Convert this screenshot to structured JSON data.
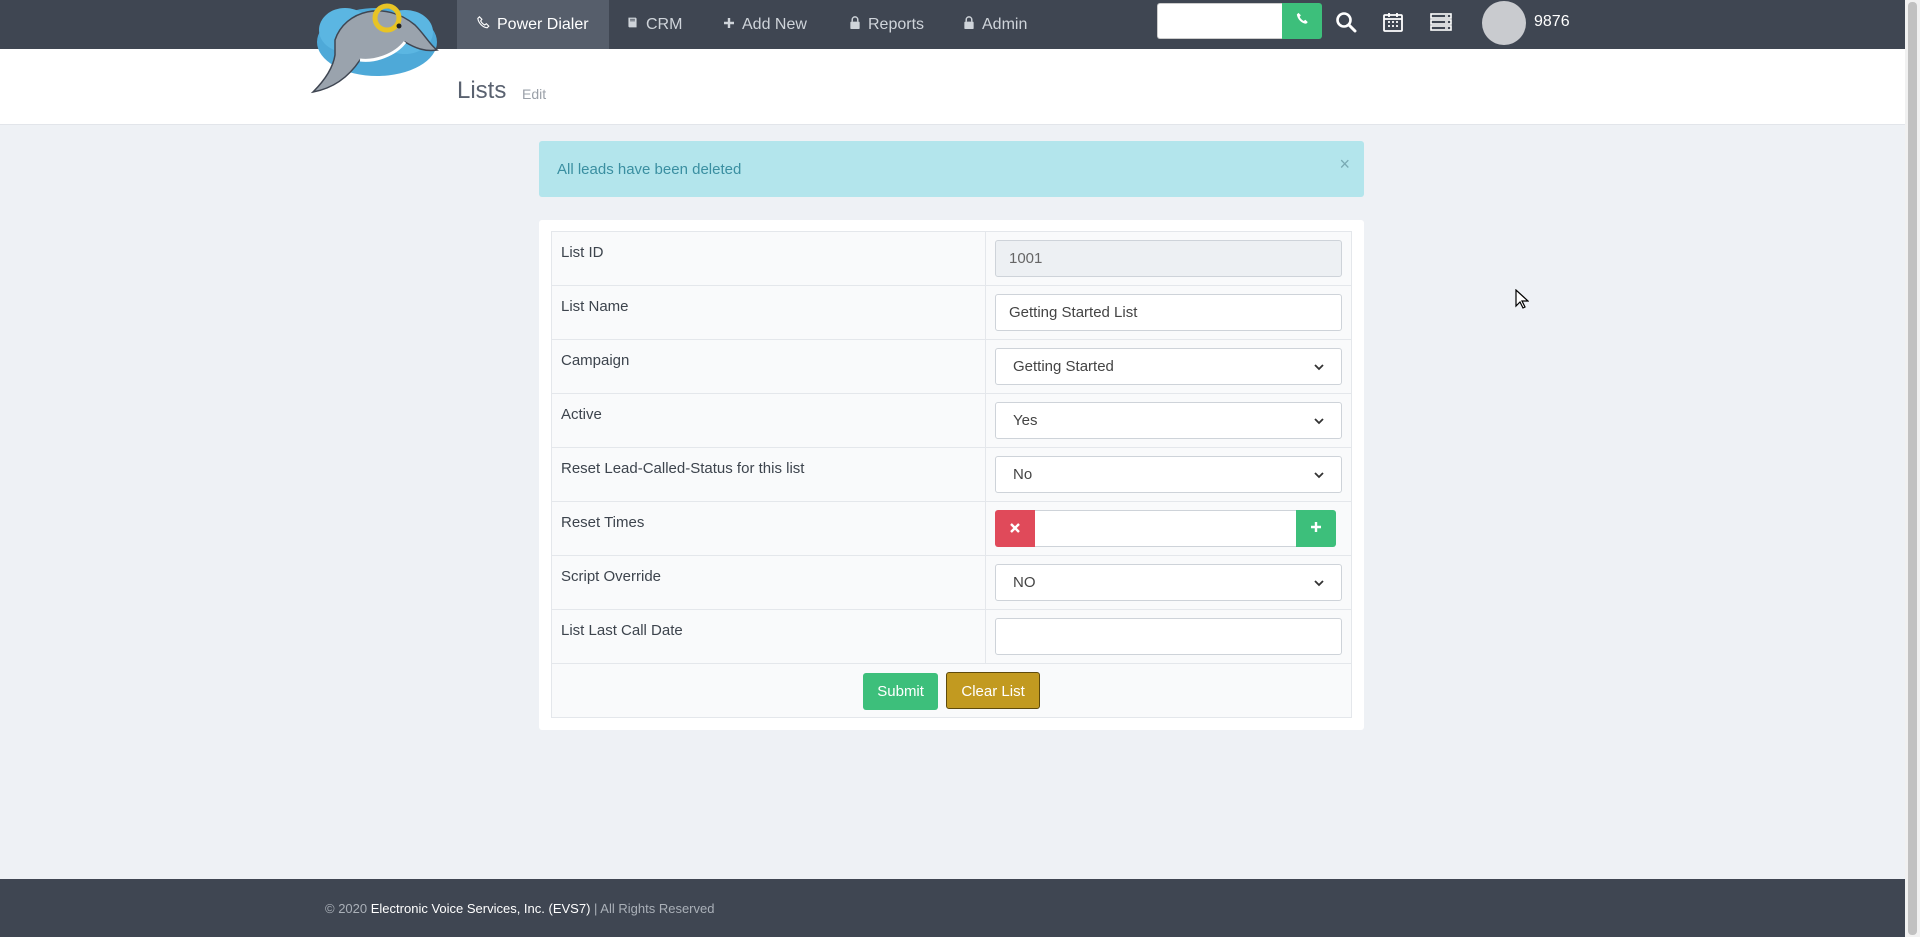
{
  "nav": {
    "items": [
      {
        "label": "Power Dialer",
        "icon": "phone-icon",
        "active": true
      },
      {
        "label": "CRM",
        "icon": "book-icon",
        "active": false
      },
      {
        "label": "Add New",
        "icon": "plus-icon",
        "active": false
      },
      {
        "label": "Reports",
        "icon": "lock-icon",
        "active": false
      },
      {
        "label": "Admin",
        "icon": "lock-icon",
        "active": false
      }
    ],
    "search_value": "",
    "extension": "9876"
  },
  "header": {
    "title": "Lists",
    "edit_label": "Edit"
  },
  "alert": {
    "message": "All leads have been deleted",
    "close": "×"
  },
  "form": {
    "rows": [
      {
        "label": "List ID",
        "type": "readonly",
        "value": "1001"
      },
      {
        "label": "List Name",
        "type": "text",
        "value": "Getting Started List"
      },
      {
        "label": "Campaign",
        "type": "select",
        "value": "Getting Started"
      },
      {
        "label": "Active",
        "type": "select",
        "value": "Yes"
      },
      {
        "label": "Reset Lead-Called-Status for this list",
        "type": "select",
        "value": "No"
      },
      {
        "label": "Reset Times",
        "type": "reset",
        "value": ""
      },
      {
        "label": "Script Override",
        "type": "select",
        "value": "NO"
      },
      {
        "label": "List Last Call Date",
        "type": "text",
        "value": ""
      }
    ],
    "submit_label": "Submit",
    "clear_label": "Clear List"
  },
  "footer": {
    "copyright": "© 2020",
    "company": "Electronic Voice Services, Inc. (EVS7)",
    "rights": "| All Rights Reserved"
  },
  "colors": {
    "nav_bg": "#3f4652",
    "success": "#3dbf7b",
    "danger": "#e04a5a",
    "warning": "#c29a20",
    "alert_bg": "#b3e5ec"
  }
}
